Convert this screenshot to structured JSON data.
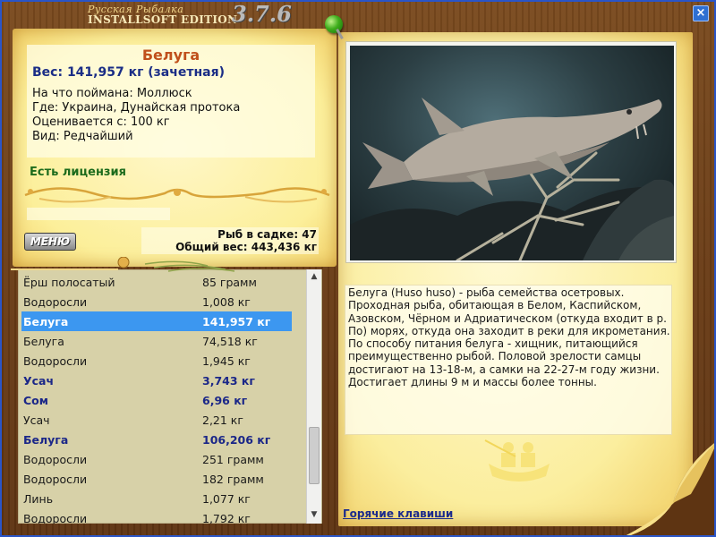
{
  "window": {
    "title_small": "Русская Рыбалка",
    "title_main": "INSTALLSOFT EDITION",
    "version": "3.7.6",
    "close_label": "×"
  },
  "fish_info": {
    "name": "Белуга",
    "weight": "Вес: 141,957 кг (зачетная)",
    "caught_on": "На что поймана: Моллюск",
    "location": "Где: Украина, Дунайская протока",
    "rated_from": "Оценивается с: 100 кг",
    "rarity": "Вид: Редчайший",
    "license": "Есть лицензия"
  },
  "menu_button": "МЕНЮ",
  "stats": {
    "fish_in_keepnet": "Рыб в садке: 47",
    "total_weight": "Общий вес: 443,436 кг"
  },
  "catch_list": {
    "rows": [
      {
        "name": "Ёрш полосатый",
        "weight": "85 грамм",
        "style": "normal"
      },
      {
        "name": "Водоросли",
        "weight": "1,008 кг",
        "style": "normal"
      },
      {
        "name": "Белуга",
        "weight": "141,957 кг",
        "style": "selected"
      },
      {
        "name": "Белуга",
        "weight": "74,518 кг",
        "style": "normal"
      },
      {
        "name": "Водоросли",
        "weight": "1,945 кг",
        "style": "normal"
      },
      {
        "name": "Усач",
        "weight": "3,743 кг",
        "style": "bold"
      },
      {
        "name": "Сом",
        "weight": "6,96 кг",
        "style": "bold"
      },
      {
        "name": "Усач",
        "weight": "2,21 кг",
        "style": "normal"
      },
      {
        "name": "Белуга",
        "weight": "106,206 кг",
        "style": "bold"
      },
      {
        "name": "Водоросли",
        "weight": "251 грамм",
        "style": "normal"
      },
      {
        "name": "Водоросли",
        "weight": "182 грамм",
        "style": "normal"
      },
      {
        "name": "Линь",
        "weight": "1,077 кг",
        "style": "normal"
      },
      {
        "name": "Водоросли",
        "weight": "1,792 кг",
        "style": "normal"
      }
    ],
    "scroll_up": "▲",
    "scroll_down": "▼"
  },
  "description": "Белуга (Huso huso) - рыба семейства осетровых. Проходная рыба, обитающая в Белом, Каспийском, Азовском, Чёрном и Адриатическом (откуда входит в р. По) морях, откуда она заходит в реки для икрометания. По способу питания белуга - хищник, питающийся преимущественно рыбой. Половой зрелости самцы достигают на 13-18-м, а самки на 22-27-м году жизни. Достигает длины 9 м и массы более тонны.",
  "hotkeys_link": "Горячие клавиши",
  "colors": {
    "frame_blue": "#2a55c8",
    "fish_name": "#c0501b",
    "weight_blue": "#1a2d86",
    "license_green": "#1c6b1c",
    "selection": "#3c97f0",
    "list_bg": "#d7d1a8"
  }
}
